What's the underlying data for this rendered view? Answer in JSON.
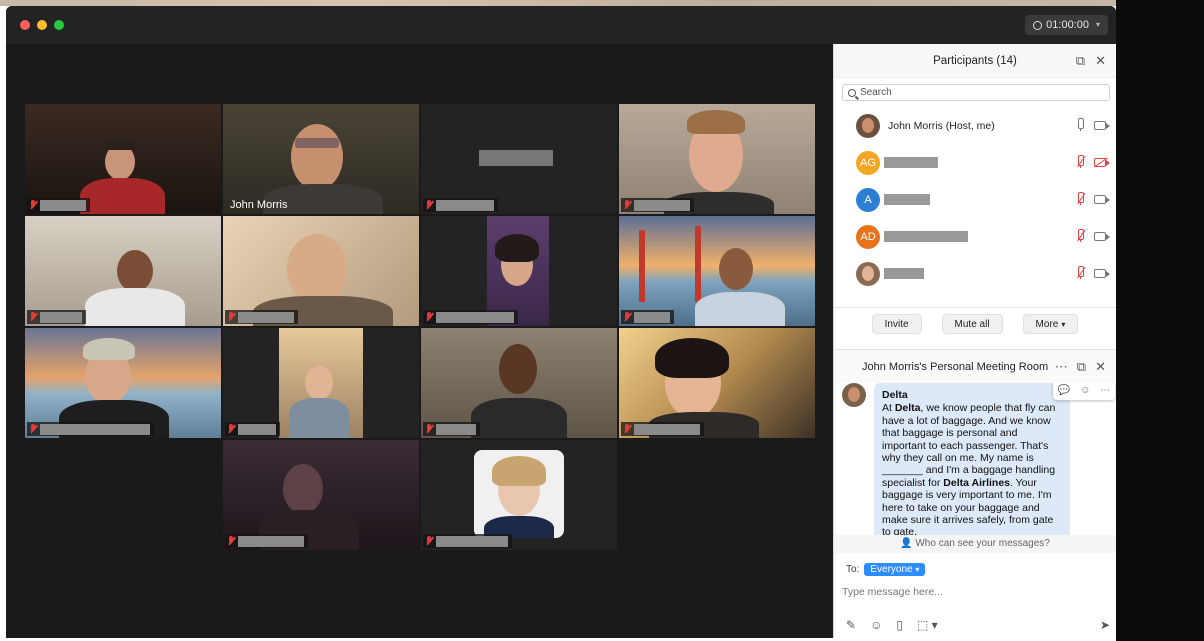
{
  "window": {
    "timer": "01:00:00",
    "colors": {
      "close": "#fe5f57",
      "minimize": "#febc2e",
      "zoom": "#28c840",
      "accent": "#2d8cff",
      "active_speaker": "#3ac33a",
      "muted": "#e34040"
    }
  },
  "gallery": {
    "tiles": [
      {
        "name": "",
        "muted": true,
        "active": false
      },
      {
        "name": "John Morris",
        "muted": false,
        "active": true
      },
      {
        "name": "",
        "muted": true,
        "active": false
      },
      {
        "name": "",
        "muted": true,
        "active": false
      },
      {
        "name": "",
        "muted": true,
        "active": false
      },
      {
        "name": "",
        "muted": true,
        "active": false
      },
      {
        "name": "",
        "muted": true,
        "active": false
      },
      {
        "name": "",
        "muted": true,
        "active": false
      },
      {
        "name": "",
        "muted": true,
        "active": false
      },
      {
        "name": "",
        "muted": true,
        "active": false
      },
      {
        "name": "",
        "muted": true,
        "active": false
      },
      {
        "name": "",
        "muted": true,
        "active": false
      },
      {
        "name": "",
        "muted": true,
        "active": false
      },
      {
        "name": "",
        "muted": true,
        "active": false
      }
    ]
  },
  "participants": {
    "title": "Participants (14)",
    "search_placeholder": "Search",
    "list": [
      {
        "initials": "",
        "name": "John Morris (Host, me)",
        "avatar_color": "#6b5040",
        "mic": "on",
        "video": "on"
      },
      {
        "initials": "AG",
        "name": "",
        "avatar_color": "#f5a623",
        "mic": "muted",
        "video": "off"
      },
      {
        "initials": "A",
        "name": "",
        "avatar_color": "#2d7fd3",
        "mic": "muted",
        "video": "on"
      },
      {
        "initials": "AD",
        "name": "",
        "avatar_color": "#e8731d",
        "mic": "muted",
        "video": "on"
      },
      {
        "initials": "",
        "name": "",
        "avatar_color": "#8c6a52",
        "mic": "muted",
        "video": "on"
      }
    ],
    "buttons": {
      "invite": "Invite",
      "mute_all": "Mute all",
      "more": "More"
    }
  },
  "chat": {
    "title": "John Morris's Personal Meeting Room",
    "message": {
      "sender": "Delta",
      "parts": [
        {
          "text": "At ",
          "bold": false
        },
        {
          "text": "Delta",
          "bold": true
        },
        {
          "text": ", we know people that fly can have a lot of baggage. And we know that baggage is personal and important to each passenger. That's why they call on me. My name is _______ and I'm a baggage handling specialist for ",
          "bold": false
        },
        {
          "text": "Delta Airlines",
          "bold": true
        },
        {
          "text": ". Your baggage is very important to me. I'm here to take on your baggage and make sure it arrives safely, from gate to gate.",
          "bold": false
        }
      ]
    },
    "who_can_see": "Who can see your messages?",
    "to_label": "To:",
    "to_value": "Everyone",
    "input_placeholder": "Type message here..."
  }
}
